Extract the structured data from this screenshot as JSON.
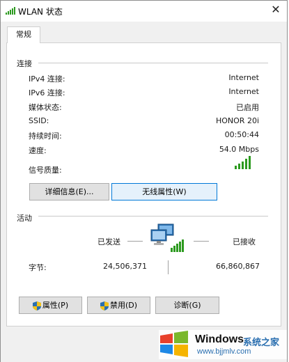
{
  "window": {
    "title": "WLAN 状态",
    "close_label": "✕"
  },
  "tabs": [
    {
      "label": "常规"
    }
  ],
  "connection": {
    "section_title": "连接",
    "rows": [
      {
        "label": "IPv4 连接:",
        "value": "Internet"
      },
      {
        "label": "IPv6 连接:",
        "value": "Internet"
      },
      {
        "label": "媒体状态:",
        "value": "已启用"
      },
      {
        "label": "SSID:",
        "value": "HONOR 20i"
      },
      {
        "label": "持续时间:",
        "value": "00:50:44"
      },
      {
        "label": "速度:",
        "value": "54.0 Mbps"
      }
    ],
    "signal_label": "信号质量:",
    "signal_bars": 5
  },
  "buttons": {
    "details": "详细信息(E)...",
    "wireless_props": "无线属性(W)"
  },
  "activity": {
    "section_title": "活动",
    "sent_label": "已发送",
    "received_label": "已接收",
    "bytes_label": "字节:",
    "bytes_sent": "24,506,371",
    "bytes_received": "66,860,867"
  },
  "bottom_buttons": {
    "properties": "属性(P)",
    "disable": "禁用(D)",
    "diagnose": "诊断(G)"
  },
  "watermark": {
    "brand": "Windows",
    "suffix": "系统之家",
    "url": "www.bjjmlv.com"
  },
  "colors": {
    "accent": "#0078d7",
    "signal_green": "#2c9a1f",
    "watermark_blue": "#2a6fb0"
  },
  "icons": [
    "wifi-signal-icon",
    "close-icon",
    "network-computers-icon",
    "uac-shield-icon",
    "windows-logo-icon"
  ]
}
